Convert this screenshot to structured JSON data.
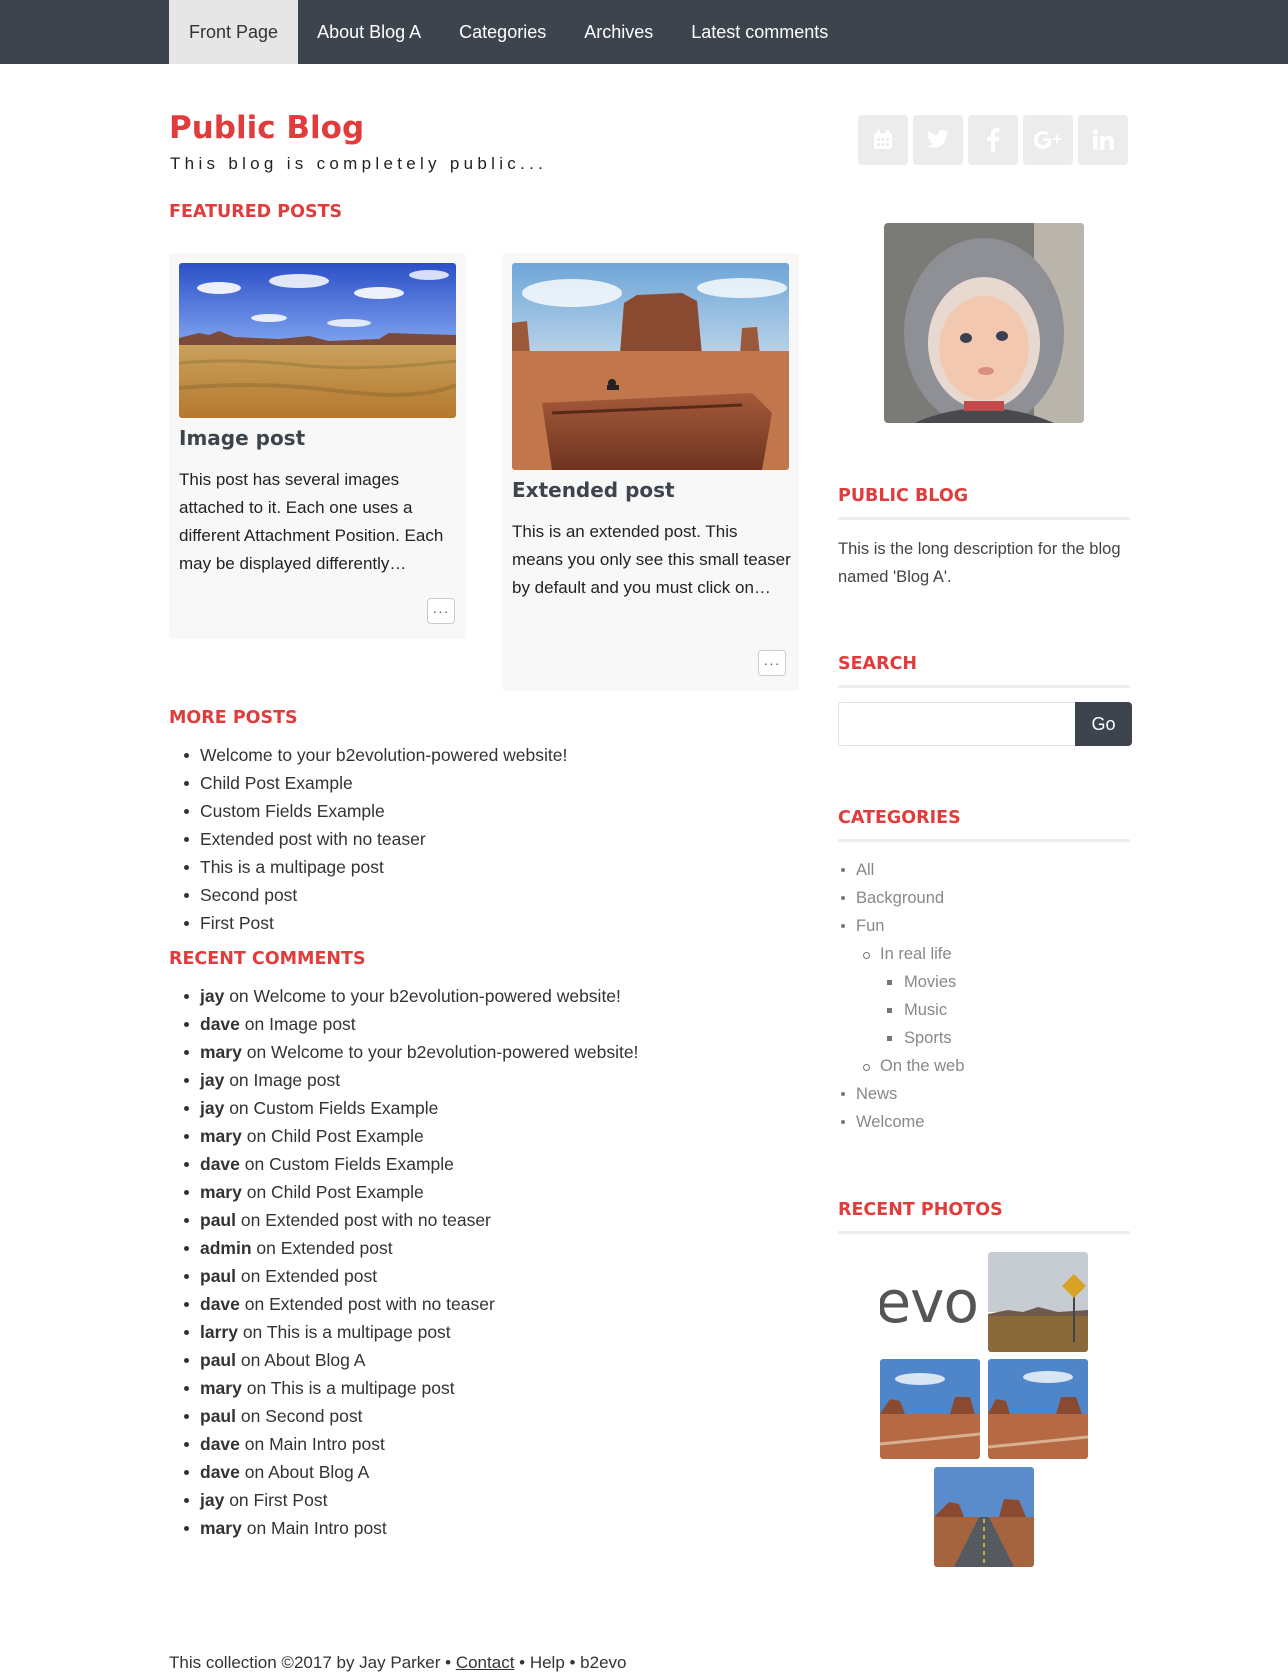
{
  "nav": {
    "items": [
      "Front Page",
      "About Blog A",
      "Categories",
      "Archives",
      "Latest comments"
    ],
    "active_index": 0
  },
  "header": {
    "title": "Public Blog",
    "tagline": "This blog is completely public..."
  },
  "social": [
    "calendar-icon",
    "twitter-icon",
    "facebook-icon",
    "google-plus-icon",
    "linkedin-icon"
  ],
  "featured": {
    "heading": "FEATURED POSTS",
    "posts": [
      {
        "title": "Image post",
        "teaser": "This post has several images attached to it. Each one uses a different Attachment Position. Each may be displayed differently…",
        "more": "···"
      },
      {
        "title": "Extended post",
        "teaser": "This is an extended post. This means you only see this small teaser by default and you must click on…",
        "more": "···"
      }
    ]
  },
  "more_posts": {
    "heading": "MORE POSTS",
    "items": [
      "Welcome to your b2evolution-powered website!",
      "Child Post Example",
      "Custom Fields Example",
      "Extended post with no teaser",
      "This is a multipage post",
      "Second post",
      "First Post"
    ]
  },
  "recent_comments": {
    "heading": "RECENT COMMENTS",
    "items": [
      {
        "user": "jay",
        "sep": " on ",
        "post": "Welcome to your b2evolution-powered website!"
      },
      {
        "user": "dave",
        "sep": " on ",
        "post": "Image post"
      },
      {
        "user": "mary",
        "sep": " on ",
        "post": "Welcome to your b2evolution-powered website!"
      },
      {
        "user": "jay",
        "sep": " on ",
        "post": "Image post"
      },
      {
        "user": "jay",
        "sep": " on ",
        "post": "Custom Fields Example"
      },
      {
        "user": "mary",
        "sep": " on ",
        "post": "Child Post Example"
      },
      {
        "user": "dave",
        "sep": " on ",
        "post": "Custom Fields Example"
      },
      {
        "user": "mary",
        "sep": " on ",
        "post": "Child Post Example"
      },
      {
        "user": "paul",
        "sep": " on ",
        "post": "Extended post with no teaser"
      },
      {
        "user": "admin",
        "sep": " on ",
        "post": "Extended post"
      },
      {
        "user": "paul",
        "sep": " on ",
        "post": "Extended post"
      },
      {
        "user": "dave",
        "sep": " on ",
        "post": "Extended post with no teaser"
      },
      {
        "user": "larry",
        "sep": " on ",
        "post": "This is a multipage post"
      },
      {
        "user": "paul",
        "sep": " on ",
        "post": "About Blog A"
      },
      {
        "user": "mary",
        "sep": " on ",
        "post": "This is a multipage post"
      },
      {
        "user": "paul",
        "sep": " on ",
        "post": "Second post"
      },
      {
        "user": "dave",
        "sep": " on ",
        "post": "Main Intro post"
      },
      {
        "user": "dave",
        "sep": " on ",
        "post": "About Blog A"
      },
      {
        "user": "jay",
        "sep": " on ",
        "post": "First Post"
      },
      {
        "user": "mary",
        "sep": " on ",
        "post": "Main Intro post"
      }
    ]
  },
  "sidebar": {
    "blog_heading": "PUBLIC BLOG",
    "blog_description": "This is the long description for the blog named 'Blog A'.",
    "search_heading": "SEARCH",
    "search_value": "",
    "search_button": "Go",
    "categories_heading": "CATEGORIES",
    "categories": [
      {
        "label": "All",
        "level": 0
      },
      {
        "label": "Background",
        "level": 0
      },
      {
        "label": "Fun",
        "level": 0
      },
      {
        "label": "In real life",
        "level": 1
      },
      {
        "label": "Movies",
        "level": 2
      },
      {
        "label": "Music",
        "level": 2
      },
      {
        "label": "Sports",
        "level": 2
      },
      {
        "label": "On the web",
        "level": 1
      },
      {
        "label": "News",
        "level": 0
      },
      {
        "label": "Welcome",
        "level": 0
      }
    ],
    "photos_heading": "RECENT PHOTOS",
    "photo_logo_text": "evo"
  },
  "footer": {
    "prefix": "This collection ©2017 by Jay Parker • ",
    "contact": "Contact",
    "mid": " • Help • b2evo"
  },
  "colors": {
    "accent": "#e03c3c",
    "nav_bg": "#3d444e",
    "nav_active_bg": "#e6e6e6",
    "card_bg": "#f8f8f8"
  }
}
